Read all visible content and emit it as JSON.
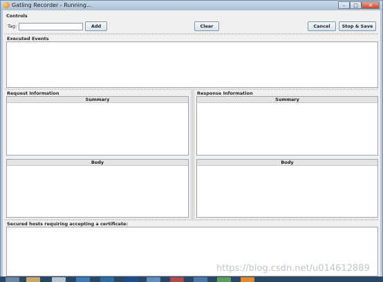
{
  "window": {
    "title": "Gatling Recorder - Running..."
  },
  "window_controls": {
    "minimize": "–",
    "maximize": "□",
    "close": "✕"
  },
  "controls": {
    "legend": "Controls",
    "tag_label": "Tag:",
    "tag_value": "",
    "add_label": "Add",
    "clear_label": "Clear",
    "cancel_label": "Cancel",
    "stop_save_label": "Stop & Save"
  },
  "executed_events": {
    "legend": "Executed Events"
  },
  "request_info": {
    "legend": "Request Information",
    "summary_title": "Summary",
    "body_title": "Body"
  },
  "response_info": {
    "legend": "Response Information",
    "summary_title": "Summary",
    "body_title": "Body"
  },
  "secured_hosts": {
    "legend": "Secured hosts requiring accepting a certificate:"
  },
  "watermark": "https://blog.csdn.net/u014612889"
}
